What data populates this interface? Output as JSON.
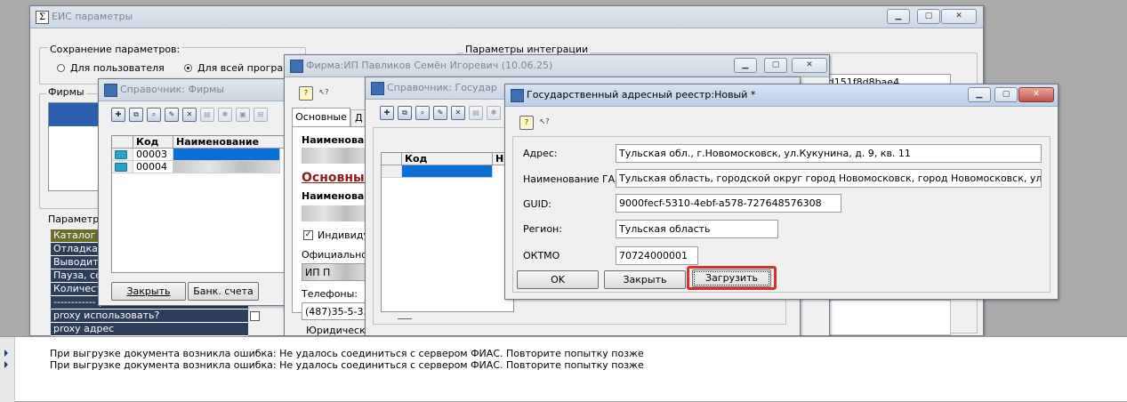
{
  "main_window": {
    "title": "ЕИС параметры",
    "save_group_label": "Сохранение параметров:",
    "radio_user": "Для пользователя",
    "radio_all": "Для всей програм",
    "integration_label": "Параметры интеграции",
    "firms_label": "Фирмы",
    "params_label": "Параметры",
    "hash_fragment": "b40ed151f8d8bae4",
    "params_rows": [
      "Каталог м",
      "Отладка з",
      "Выводить",
      "Пауза, сек",
      "Количеств",
      "------------ pr",
      "proxy использовать?",
      "proxy адрес"
    ]
  },
  "firms_ref": {
    "title": "Справочник: Фирмы",
    "col_code": "Код",
    "col_name": "Наименование",
    "rows": [
      {
        "code": "00003"
      },
      {
        "code": "00004"
      }
    ],
    "close_label": "Закрыть",
    "bank_label": "Банк. счета"
  },
  "firm_form": {
    "title": "Фирма:ИП Павликов Семён Игоревич (10.06.25)",
    "tab_main": "Основные",
    "tab_other": "Д",
    "name_label": "Наименован",
    "section_title": "Основные",
    "name_label2": "Наименован",
    "individual_label": "Индивиду",
    "official_label": "Официальное",
    "official_value": "ИП П",
    "phones_label": "Телефоны:",
    "phones_value": "(487)35-5-33-3",
    "legal_label": "Юридический"
  },
  "gov_ref": {
    "title": "Справочник: Государ",
    "col_code": "Код",
    "col_name": "Н"
  },
  "gar_form": {
    "title": "Государственный адресный реестр:Новый *",
    "address_label": "Адрес:",
    "address_value": "Тульская обл., г.Новомосковск, ул.Кукунина, д. 9, кв. 11",
    "gar_name_label": "Наименование ГАР:",
    "gar_name_value": "Тульская область, городской округ город Новомосковск, город Новомосковск, улица Кукун",
    "guid_label": "GUID:",
    "guid_value": "9000fecf-5310-4ebf-a578-727648576308",
    "region_label": "Регион:",
    "region_value": "Тульская область",
    "oktmo_label": "ОКТМО",
    "oktmo_value": "70724000001",
    "ok_label": "OK",
    "close_label": "Закрыть",
    "load_label": "Загрузить",
    "highlight_color": "#d9302c"
  },
  "log": {
    "lines": [
      "При выгрузке документа возникла ошибка: Не удалось соединиться с сервером ФИАС. Повторите попытку позже",
      "При выгрузке документа возникла ошибка: Не удалось соединиться с сервером ФИАС. Повторите попытку позже"
    ]
  }
}
